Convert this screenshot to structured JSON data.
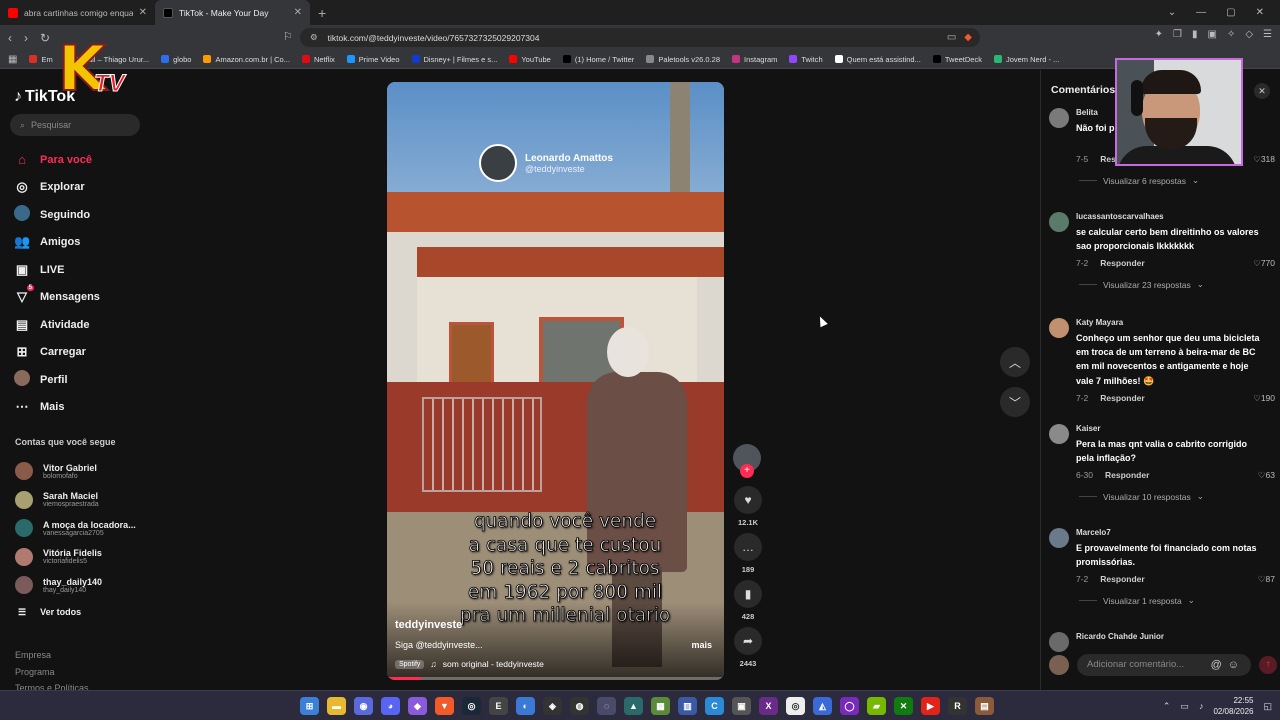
{
  "browser": {
    "tabs": [
      {
        "title": "abra cartinhas comigo enquanto con",
        "fav_color": "#ff0000"
      },
      {
        "title": "TikTok - Make Your Day",
        "fav_color": "#000000"
      }
    ],
    "url": "tiktok.com/@teddyinveste/video/7657327325029207304",
    "bookmarks": [
      {
        "label": "Em",
        "color": "#d93025"
      },
      {
        "label": "Email – Thiago Urur...",
        "color": "#4a7bd0"
      },
      {
        "label": "globo",
        "color": "#2b6ef0"
      },
      {
        "label": "Amazon.com.br | Co...",
        "color": "#ff9900"
      },
      {
        "label": "Netflix",
        "color": "#e50914"
      },
      {
        "label": "Prime Video",
        "color": "#1a98ff"
      },
      {
        "label": "Disney+ | Filmes e s...",
        "color": "#113ccf"
      },
      {
        "label": "YouTube",
        "color": "#ff0000"
      },
      {
        "label": "(1) Home / Twitter",
        "color": "#000000"
      },
      {
        "label": "Paletools v26.0.28",
        "color": "#888888"
      },
      {
        "label": "Instagram",
        "color": "#c13584"
      },
      {
        "label": "Twitch",
        "color": "#9146ff"
      },
      {
        "label": "Quem está assistind...",
        "color": "#ffffff"
      },
      {
        "label": "TweetDeck",
        "color": "#000000"
      },
      {
        "label": "Jovem Nerd - ...",
        "color": "#2bb673"
      }
    ]
  },
  "sidebar": {
    "logo": "TikTok",
    "search_placeholder": "Pesquisar",
    "nav": [
      {
        "label": "Para você",
        "icon": "home-icon",
        "glyph": "⌂",
        "active": true
      },
      {
        "label": "Explorar",
        "icon": "compass-icon",
        "glyph": "◎",
        "active": false
      },
      {
        "label": "Seguindo",
        "icon": "following-icon",
        "glyph": "●",
        "active": false
      },
      {
        "label": "Amigos",
        "icon": "friends-icon",
        "glyph": "👥",
        "active": false
      },
      {
        "label": "LIVE",
        "icon": "live-icon",
        "glyph": "▣",
        "active": false
      },
      {
        "label": "Mensagens",
        "icon": "messages-icon",
        "glyph": "▽",
        "active": false,
        "badge": "5"
      },
      {
        "label": "Atividade",
        "icon": "activity-icon",
        "glyph": "▤",
        "active": false
      },
      {
        "label": "Carregar",
        "icon": "upload-icon",
        "glyph": "⊞",
        "active": false
      },
      {
        "label": "Perfil",
        "icon": "profile-icon",
        "glyph": "●",
        "active": false
      },
      {
        "label": "Mais",
        "icon": "more-icon",
        "glyph": "⋯",
        "active": false
      }
    ],
    "following_header": "Contas que você segue",
    "following": [
      {
        "name": "Vitor Gabriel",
        "user": "bolomofafo",
        "color": "#8a5a4a"
      },
      {
        "name": "Sarah Maciel",
        "user": "viemospraestrada",
        "color": "#a8a070"
      },
      {
        "name": "A moça da locadora...",
        "user": "vanessagarcia2705",
        "color": "#2a6a6a"
      },
      {
        "name": "Vitória Fidelis",
        "user": "victoriafidelis5",
        "color": "#b07a70"
      },
      {
        "name": "thay_daily140",
        "user": "thay_daily140",
        "color": "#7a5a5a"
      }
    ],
    "see_all": "Ver todos",
    "footer": [
      "Empresa",
      "Programa",
      "Termos e Políticas"
    ]
  },
  "video": {
    "creator_name": "Leonardo Amattos",
    "creator_handle": "@teddyinveste",
    "caption_lines": [
      "quando você vende",
      "a casa que te custou",
      "50 reais e 2 cabritos",
      "em 1962 por 800 mil",
      "pra um millenial otario"
    ],
    "author": "teddyinveste",
    "description": "Siga @teddyinveste...",
    "more": "mais",
    "spotify": "Spotify",
    "music": "som original - teddyinveste",
    "progress": 0.1
  },
  "actions": {
    "likes": "12.1K",
    "comments": "189",
    "saves": "428",
    "shares": "2443"
  },
  "comments": {
    "title": "Comentários",
    "items": [
      {
        "user": "Belita",
        "text": "Não foi p... os esse din...",
        "date": "7-5",
        "reply": "Responder",
        "likes": "318",
        "replies": "Visualizar 6 respostas",
        "color": "#7a7a7a"
      },
      {
        "user": "lucassantoscarvalhaes",
        "text": "se calcular certo bem direitinho os valores sao proporcionais lkkkkkkk",
        "date": "7-2",
        "reply": "Responder",
        "likes": "770",
        "replies": "Visualizar 23 respostas",
        "color": "#5a7a6a"
      },
      {
        "user": "Katy Mayara",
        "text": "Conheço um senhor que deu uma bicicleta em troca de um terreno à beira-mar de BC em mil novecentos e antigamente e hoje vale 7 milhões! 🤩",
        "date": "7-2",
        "reply": "Responder",
        "likes": "190",
        "replies": "",
        "color": "#c09070"
      },
      {
        "user": "Kaiser",
        "text": "Pera la mas qnt valia o cabrito corrigido pela inflação?",
        "date": "6-30",
        "reply": "Responder",
        "likes": "63",
        "replies": "Visualizar 10 respostas",
        "color": "#8a8a8a"
      },
      {
        "user": "Marcelo7",
        "text": "E provavelmente foi financiado com notas promissórias.",
        "date": "7-2",
        "reply": "Responder",
        "likes": "87",
        "replies": "Visualizar 1 resposta",
        "color": "#6a7a8a"
      },
      {
        "user": "Ricardo Chahde Junior",
        "text": "",
        "date": "",
        "reply": "",
        "likes": "",
        "replies": "",
        "color": "#6a6a6a"
      }
    ],
    "input_placeholder": "Adicionar comentário..."
  },
  "taskbar": {
    "time": "22:55",
    "date": "02/08/2026"
  }
}
